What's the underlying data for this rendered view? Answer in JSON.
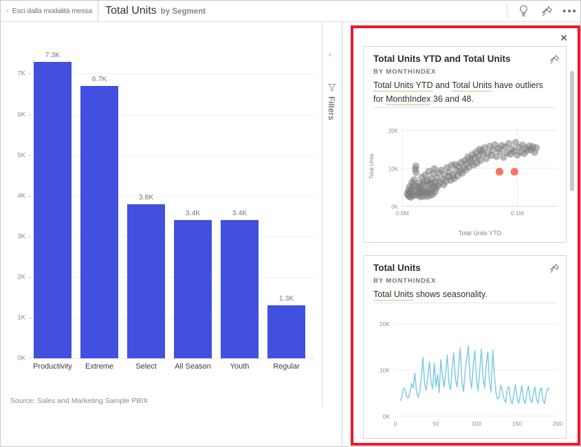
{
  "topbar": {
    "exit_chevron": "‹",
    "exit_label": "Esci dalla modalità messa",
    "title": "Total Units",
    "subtitle": "by Segment",
    "insights_icon_name": "lightbulb-icon",
    "pin_icon_name": "pin-icon",
    "more_label": "•••"
  },
  "canvas": {
    "source_note": "Source: Sales and Marketing Sample PBIX",
    "filters_label": "Filters",
    "filters_chevron": "‹"
  },
  "insights": {
    "close_label": "✕",
    "scrollbar_visible": true,
    "cards": [
      {
        "title": "Total Units YTD and Total Units",
        "subtitle": "BY MONTHINDEX",
        "body_parts": [
          {
            "text": "Total Units YTD",
            "ref": true
          },
          {
            "text": " and ",
            "ref": false
          },
          {
            "text": "Total Units",
            "ref": true
          },
          {
            "text": " have outliers for ",
            "ref": false
          },
          {
            "text": "MonthIndex",
            "ref": true
          },
          {
            "text": " 36 and 48.",
            "ref": false
          }
        ],
        "pin_icon_name": "pin-icon"
      },
      {
        "title": "Total Units",
        "subtitle": "BY MONTHINDEX",
        "body_parts": [
          {
            "text": "Total Units",
            "ref": true
          },
          {
            "text": " shows seasonality.",
            "ref": false
          }
        ],
        "pin_icon_name": "pin-icon"
      }
    ]
  },
  "chart_data": [
    {
      "type": "bar",
      "title": "Total Units",
      "subtitle": "by Segment",
      "xlabel": "",
      "ylabel": "",
      "categories": [
        "Productivity",
        "Extreme",
        "Select",
        "All Season",
        "Youth",
        "Regular"
      ],
      "values": [
        7300,
        6700,
        3800,
        3400,
        3400,
        1300
      ],
      "data_labels": [
        "7.3K",
        "6.7K",
        "3.8K",
        "3.4K",
        "3.4K",
        "1.3K"
      ],
      "ytick_labels": [
        "0K",
        "1K",
        "2K",
        "3K",
        "4K",
        "5K",
        "6K",
        "7K"
      ],
      "ytick_values": [
        0,
        1000,
        2000,
        3000,
        4000,
        5000,
        6000,
        7000
      ],
      "ylim": [
        0,
        7600
      ],
      "grid": true,
      "legend": "none",
      "bar_color": "#4150de",
      "source": "Source: Sales and Marketing Sample PBIX"
    },
    {
      "type": "scatter",
      "title": "Total Units YTD and Total Units by MonthIndex",
      "xlabel": "Total Units YTD",
      "ylabel": "Total Units",
      "xtick_labels": [
        "0.0M",
        "0.1M"
      ],
      "xtick_values": [
        0,
        0.1
      ],
      "ytick_labels": [
        "0K",
        "10K",
        "20K"
      ],
      "ytick_values": [
        0,
        10000,
        20000
      ],
      "xlim": [
        0,
        0.135
      ],
      "ylim": [
        0,
        21000
      ],
      "grid": true,
      "legend": "none",
      "point_color": "#7a7a7a",
      "outlier_color": "#fb6b5b",
      "outliers": [
        {
          "x": 0.0845,
          "y": 9100,
          "label": "MonthIndex 36"
        },
        {
          "x": 0.0975,
          "y": 9100,
          "label": "MonthIndex 48"
        }
      ],
      "points": [
        {
          "x": 0.0045,
          "y": 3400
        },
        {
          "x": 0.005,
          "y": 3000
        },
        {
          "x": 0.0055,
          "y": 4200
        },
        {
          "x": 0.006,
          "y": 2600
        },
        {
          "x": 0.0065,
          "y": 5200
        },
        {
          "x": 0.007,
          "y": 3800
        },
        {
          "x": 0.0075,
          "y": 2400
        },
        {
          "x": 0.008,
          "y": 4600
        },
        {
          "x": 0.0085,
          "y": 6300
        },
        {
          "x": 0.009,
          "y": 3100
        },
        {
          "x": 0.0095,
          "y": 5500
        },
        {
          "x": 0.01,
          "y": 2800
        },
        {
          "x": 0.0105,
          "y": 7000
        },
        {
          "x": 0.011,
          "y": 4100
        },
        {
          "x": 0.0115,
          "y": 9800
        },
        {
          "x": 0.0118,
          "y": 10600
        },
        {
          "x": 0.012,
          "y": 8900
        },
        {
          "x": 0.0125,
          "y": 5300
        },
        {
          "x": 0.013,
          "y": 3600
        },
        {
          "x": 0.0135,
          "y": 2900
        },
        {
          "x": 0.014,
          "y": 4700
        },
        {
          "x": 0.0145,
          "y": 6100
        },
        {
          "x": 0.015,
          "y": 3300
        },
        {
          "x": 0.0155,
          "y": 5000
        },
        {
          "x": 0.016,
          "y": 2500
        },
        {
          "x": 0.0165,
          "y": 4400
        },
        {
          "x": 0.017,
          "y": 7600
        },
        {
          "x": 0.0175,
          "y": 3900
        },
        {
          "x": 0.018,
          "y": 5800
        },
        {
          "x": 0.0185,
          "y": 2700
        },
        {
          "x": 0.019,
          "y": 6500
        },
        {
          "x": 0.0195,
          "y": 4000
        },
        {
          "x": 0.02,
          "y": 8200
        },
        {
          "x": 0.0205,
          "y": 3500
        },
        {
          "x": 0.021,
          "y": 5600
        },
        {
          "x": 0.0215,
          "y": 2600
        },
        {
          "x": 0.022,
          "y": 6800
        },
        {
          "x": 0.0225,
          "y": 4300
        },
        {
          "x": 0.023,
          "y": 9200
        },
        {
          "x": 0.0235,
          "y": 3700
        },
        {
          "x": 0.024,
          "y": 5900
        },
        {
          "x": 0.0245,
          "y": 2900
        },
        {
          "x": 0.025,
          "y": 7200
        },
        {
          "x": 0.0255,
          "y": 4500
        },
        {
          "x": 0.026,
          "y": 6000
        },
        {
          "x": 0.0265,
          "y": 3200
        },
        {
          "x": 0.027,
          "y": 8600
        },
        {
          "x": 0.0275,
          "y": 5100
        },
        {
          "x": 0.028,
          "y": 9900
        },
        {
          "x": 0.0285,
          "y": 3800
        },
        {
          "x": 0.029,
          "y": 6400
        },
        {
          "x": 0.0295,
          "y": 4800
        },
        {
          "x": 0.03,
          "y": 7400
        },
        {
          "x": 0.031,
          "y": 5400
        },
        {
          "x": 0.032,
          "y": 8800
        },
        {
          "x": 0.033,
          "y": 6200
        },
        {
          "x": 0.034,
          "y": 9500
        },
        {
          "x": 0.035,
          "y": 7100
        },
        {
          "x": 0.036,
          "y": 5700
        },
        {
          "x": 0.037,
          "y": 8300
        },
        {
          "x": 0.038,
          "y": 6600
        },
        {
          "x": 0.039,
          "y": 10200
        },
        {
          "x": 0.04,
          "y": 7800
        },
        {
          "x": 0.041,
          "y": 9000
        },
        {
          "x": 0.042,
          "y": 6900
        },
        {
          "x": 0.043,
          "y": 10800
        },
        {
          "x": 0.044,
          "y": 8100
        },
        {
          "x": 0.045,
          "y": 7300
        },
        {
          "x": 0.046,
          "y": 11000
        },
        {
          "x": 0.047,
          "y": 9400
        },
        {
          "x": 0.048,
          "y": 8000
        },
        {
          "x": 0.049,
          "y": 10500
        },
        {
          "x": 0.05,
          "y": 9100
        },
        {
          "x": 0.051,
          "y": 11500
        },
        {
          "x": 0.052,
          "y": 8700
        },
        {
          "x": 0.053,
          "y": 10000
        },
        {
          "x": 0.054,
          "y": 12000
        },
        {
          "x": 0.055,
          "y": 9600
        },
        {
          "x": 0.056,
          "y": 11200
        },
        {
          "x": 0.057,
          "y": 13000
        },
        {
          "x": 0.058,
          "y": 10300
        },
        {
          "x": 0.059,
          "y": 12400
        },
        {
          "x": 0.06,
          "y": 11700
        },
        {
          "x": 0.061,
          "y": 13600
        },
        {
          "x": 0.062,
          "y": 10900
        },
        {
          "x": 0.063,
          "y": 12800
        },
        {
          "x": 0.064,
          "y": 14200
        },
        {
          "x": 0.065,
          "y": 11400
        },
        {
          "x": 0.066,
          "y": 13200
        },
        {
          "x": 0.067,
          "y": 15000
        },
        {
          "x": 0.068,
          "y": 12100
        },
        {
          "x": 0.069,
          "y": 14600
        },
        {
          "x": 0.07,
          "y": 13800
        },
        {
          "x": 0.0715,
          "y": 15400
        },
        {
          "x": 0.073,
          "y": 12600
        },
        {
          "x": 0.0745,
          "y": 14000
        },
        {
          "x": 0.076,
          "y": 15800
        },
        {
          "x": 0.0775,
          "y": 13400
        },
        {
          "x": 0.079,
          "y": 14800
        },
        {
          "x": 0.0805,
          "y": 16200
        },
        {
          "x": 0.082,
          "y": 13100
        },
        {
          "x": 0.0835,
          "y": 15200
        },
        {
          "x": 0.085,
          "y": 14400
        },
        {
          "x": 0.0865,
          "y": 16000
        },
        {
          "x": 0.088,
          "y": 12900
        },
        {
          "x": 0.0895,
          "y": 15600
        },
        {
          "x": 0.091,
          "y": 14100
        },
        {
          "x": 0.0925,
          "y": 16500
        },
        {
          "x": 0.094,
          "y": 13700
        },
        {
          "x": 0.0955,
          "y": 15100
        },
        {
          "x": 0.097,
          "y": 14500
        },
        {
          "x": 0.0985,
          "y": 16800
        },
        {
          "x": 0.1,
          "y": 13500
        },
        {
          "x": 0.1015,
          "y": 15500
        },
        {
          "x": 0.103,
          "y": 14300
        },
        {
          "x": 0.1045,
          "y": 16100
        },
        {
          "x": 0.106,
          "y": 13900
        },
        {
          "x": 0.1075,
          "y": 15300
        },
        {
          "x": 0.109,
          "y": 14700
        },
        {
          "x": 0.1105,
          "y": 15900
        },
        {
          "x": 0.112,
          "y": 14900
        },
        {
          "x": 0.1135,
          "y": 15700
        },
        {
          "x": 0.115,
          "y": 14200
        },
        {
          "x": 0.1165,
          "y": 15400
        }
      ]
    },
    {
      "type": "line",
      "title": "Total Units by MonthIndex",
      "xlabel": "",
      "ylabel": "",
      "xtick_labels": [
        "0",
        "50",
        "100",
        "150",
        "200"
      ],
      "xtick_values": [
        0,
        50,
        100,
        150,
        200
      ],
      "ytick_labels": [
        "0K",
        "10K",
        "20K"
      ],
      "ytick_values": [
        0,
        10000,
        20000
      ],
      "xlim": [
        0,
        200
      ],
      "ylim": [
        0,
        21000
      ],
      "grid": true,
      "legend": "none",
      "line_color": "#7ecbe4",
      "x": [
        6,
        8,
        10,
        12,
        14,
        16,
        18,
        20,
        22,
        24,
        26,
        28,
        30,
        32,
        34,
        36,
        38,
        40,
        42,
        44,
        46,
        48,
        50,
        52,
        54,
        56,
        58,
        60,
        62,
        64,
        66,
        68,
        70,
        72,
        74,
        76,
        78,
        80,
        82,
        84,
        86,
        88,
        90,
        92,
        94,
        96,
        98,
        100,
        102,
        104,
        106,
        108,
        110,
        112,
        114,
        116,
        118,
        120,
        122,
        124,
        126,
        128,
        130,
        132,
        134,
        136,
        138,
        140,
        142,
        144,
        146,
        148,
        150,
        152,
        154,
        156,
        158,
        160,
        162,
        164,
        166,
        168,
        170,
        172,
        174,
        176,
        178,
        180,
        182,
        184,
        186,
        188,
        190
      ],
      "values": [
        3300,
        4100,
        6000,
        5800,
        4200,
        3900,
        5000,
        7000,
        6100,
        9300,
        5400,
        4000,
        5200,
        8200,
        12700,
        6900,
        5600,
        8500,
        11800,
        7300,
        5900,
        11500,
        6400,
        9000,
        5100,
        12200,
        8800,
        6200,
        9500,
        13200,
        7100,
        5700,
        10400,
        13700,
        8000,
        6300,
        11000,
        14800,
        7600,
        5300,
        9700,
        12500,
        15200,
        8300,
        6000,
        10900,
        14200,
        7800,
        5500,
        9900,
        14500,
        8600,
        6100,
        11300,
        13900,
        7400,
        5200,
        14300,
        8900,
        5000,
        3700,
        4200,
        6700,
        5400,
        3600,
        2900,
        5900,
        6400,
        3400,
        2600,
        4800,
        6800,
        3900,
        2800,
        4500,
        6600,
        3500,
        2700,
        5000,
        6500,
        3800,
        2900,
        4700,
        6300,
        3600,
        2800,
        5200,
        6200,
        3400,
        2700,
        4900,
        6000,
        5700
      ]
    }
  ]
}
